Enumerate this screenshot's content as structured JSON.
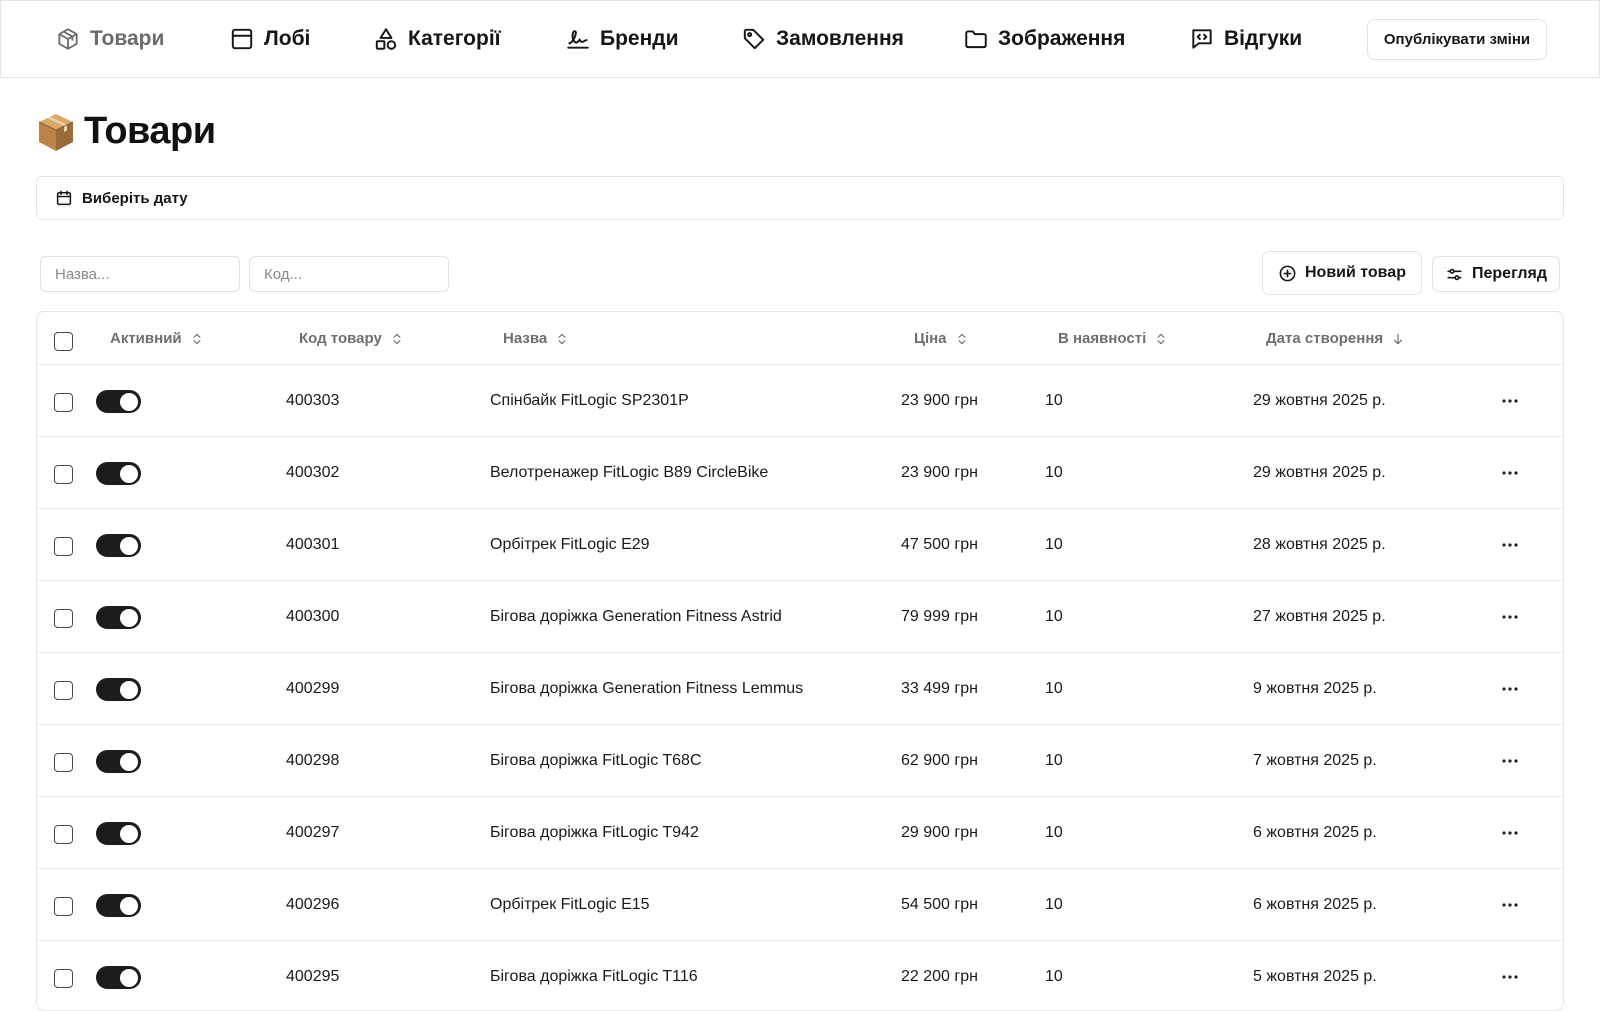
{
  "nav": {
    "items": [
      {
        "label": "Товари",
        "icon": "package-icon",
        "active": true
      },
      {
        "label": "Лобі",
        "icon": "layout-icon",
        "active": false
      },
      {
        "label": "Категорії",
        "icon": "shapes-icon",
        "active": false
      },
      {
        "label": "Бренди",
        "icon": "signature-icon",
        "active": false
      },
      {
        "label": "Замовлення",
        "icon": "tag-icon",
        "active": false
      },
      {
        "label": "Зображення",
        "icon": "folder-icon",
        "active": false
      },
      {
        "label": "Відгуки",
        "icon": "message-code-icon",
        "active": false
      }
    ],
    "publish_label": "Опублікувати зміни"
  },
  "page": {
    "emoji": "package-emoji",
    "title": "Товари"
  },
  "date_filter": {
    "label": "Виберіть дату"
  },
  "filters": {
    "name_placeholder": "Назва...",
    "code_placeholder": "Код..."
  },
  "actions": {
    "new_product": "Новий товар",
    "view": "Перегляд"
  },
  "table": {
    "columns": {
      "active": "Активний",
      "code": "Код товару",
      "name": "Назва",
      "price": "Ціна",
      "stock": "В наявності",
      "created": "Дата створення"
    },
    "rows": [
      {
        "active": true,
        "code": "400303",
        "name": "Спінбайк FitLogic SP2301P",
        "price": "23 900 грн",
        "stock": "10",
        "created": "29 жовтня 2025 р."
      },
      {
        "active": true,
        "code": "400302",
        "name": "Велотренажер FitLogic B89 CircleBike",
        "price": "23 900 грн",
        "stock": "10",
        "created": "29 жовтня 2025 р."
      },
      {
        "active": true,
        "code": "400301",
        "name": "Орбітрек FitLogic E29",
        "price": "47 500 грн",
        "stock": "10",
        "created": "28 жовтня 2025 р."
      },
      {
        "active": true,
        "code": "400300",
        "name": "Бігова доріжка Generation Fitness Astrid",
        "price": "79 999 грн",
        "stock": "10",
        "created": "27 жовтня 2025 р."
      },
      {
        "active": true,
        "code": "400299",
        "name": "Бігова доріжка Generation Fitness Lemmus",
        "price": "33 499 грн",
        "stock": "10",
        "created": "9 жовтня 2025 р."
      },
      {
        "active": true,
        "code": "400298",
        "name": "Бігова доріжка FitLogic T68C",
        "price": "62 900 грн",
        "stock": "10",
        "created": "7 жовтня 2025 р."
      },
      {
        "active": true,
        "code": "400297",
        "name": "Бігова доріжка FitLogic T942",
        "price": "29 900 грн",
        "stock": "10",
        "created": "6 жовтня 2025 р."
      },
      {
        "active": true,
        "code": "400296",
        "name": "Орбітрек FitLogic E15",
        "price": "54 500 грн",
        "stock": "10",
        "created": "6 жовтня 2025 р."
      },
      {
        "active": true,
        "code": "400295",
        "name": "Бігова доріжка FitLogic T116",
        "price": "22 200 грн",
        "stock": "10",
        "created": "5 жовтня 2025 р."
      }
    ]
  }
}
